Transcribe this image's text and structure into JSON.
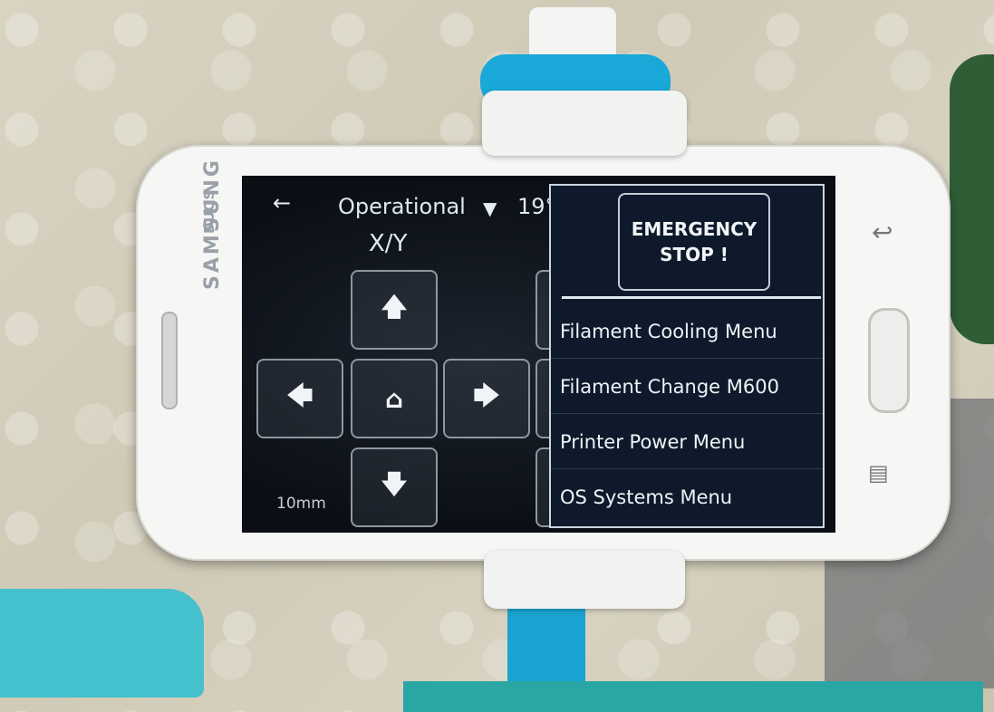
{
  "phone": {
    "brand": "SAMSUNG",
    "model": "DUOS"
  },
  "topbar": {
    "back": "←",
    "status": "Operational",
    "temp_icon": "▼",
    "temp": "19°"
  },
  "jog": {
    "title": "X/Y",
    "up": "🡅",
    "left": "🡄",
    "home": "⌂",
    "right": "🡆",
    "down": "🡇",
    "step": "10mm"
  },
  "menu": {
    "estop": "EMERGENCY STOP !",
    "items": [
      "Filament Cooling Menu",
      "Filament Change M600",
      "Printer Power Menu",
      "OS Systems Menu"
    ]
  },
  "hardware_keys": {
    "back": "↩",
    "menu": "▤"
  }
}
